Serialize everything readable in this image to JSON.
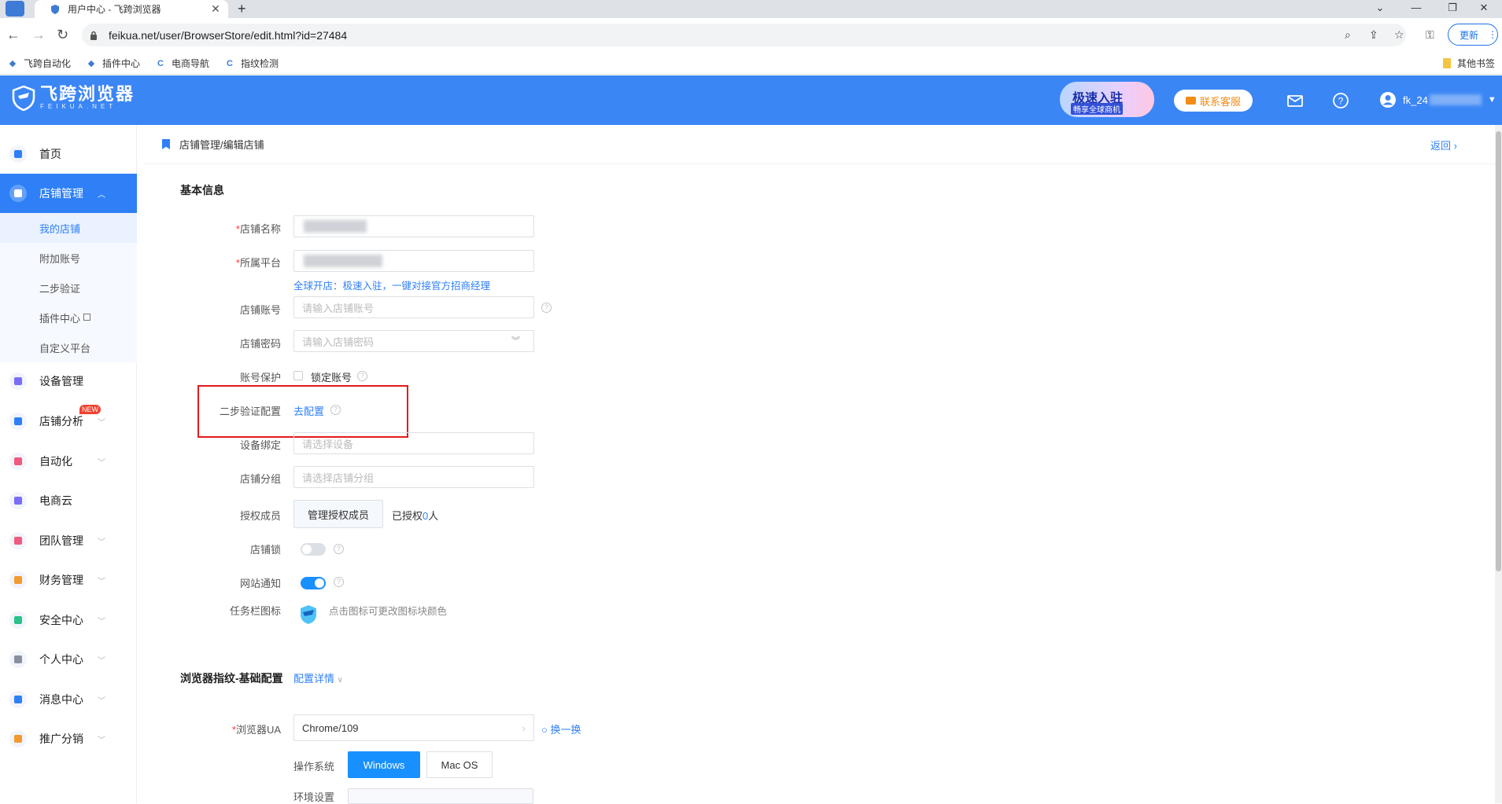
{
  "browser": {
    "tab_title": "用户中心 - 飞跨浏览器",
    "url": "feikua.net/user/BrowserStore/edit.html?id=27484",
    "update_label": "更新",
    "bookmarks": [
      "飞跨自动化",
      "插件中心",
      "电商导航",
      "指纹检测"
    ],
    "other_bookmarks": "其他书签"
  },
  "header": {
    "logo_name": "飞跨浏览器",
    "logo_sub": "FEIKUA.NET",
    "promo_line1": "极速入驻",
    "promo_line2": "畅享全球商机",
    "contact_label": "联系客服",
    "username": "fk_24"
  },
  "sidebar": {
    "items": [
      {
        "label": "首页",
        "color": "#2f80f6"
      },
      {
        "label": "店铺管理",
        "color": "#ffffff"
      },
      {
        "label": "设备管理",
        "color": "#7b6cf6"
      },
      {
        "label": "店铺分析",
        "color": "#2f80f6",
        "badge": "NEW"
      },
      {
        "label": "自动化",
        "color": "#f05a7e"
      },
      {
        "label": "电商云",
        "color": "#7b6cf6"
      },
      {
        "label": "团队管理",
        "color": "#f05a7e"
      },
      {
        "label": "财务管理",
        "color": "#f29a2e"
      },
      {
        "label": "安全中心",
        "color": "#29c287"
      },
      {
        "label": "个人中心",
        "color": "#8a8fa0"
      },
      {
        "label": "消息中心",
        "color": "#2f80f6"
      },
      {
        "label": "推广分销",
        "color": "#f29a2e"
      }
    ],
    "sub_items": [
      "我的店铺",
      "附加账号",
      "二步验证",
      "插件中心",
      "自定义平台"
    ]
  },
  "breadcrumb": "店铺管理/编辑店铺",
  "back_label": "返回",
  "form": {
    "section_basic": "基本信息",
    "store_name_label": "店铺名称",
    "platform_label": "所属平台",
    "platform_hint": "全球开店：极速入驻，一键对接官方招商经理",
    "account_label": "店铺账号",
    "account_placeholder": "请输入店铺账号",
    "password_label": "店铺密码",
    "password_placeholder": "请输入店铺密码",
    "protect_label": "账号保护",
    "lock_account": "锁定账号",
    "twostep_label": "二步验证配置",
    "twostep_link": "去配置",
    "device_label": "设备绑定",
    "device_placeholder": "请选择设备",
    "group_label": "店铺分组",
    "group_placeholder": "请选择店铺分组",
    "members_label": "授权成员",
    "members_button": "管理授权成员",
    "authorized_prefix": "已授权",
    "authorized_count": "0",
    "authorized_suffix": "人",
    "storelock_label": "店铺锁",
    "storelock_on": false,
    "notify_label": "网站通知",
    "notify_on": true,
    "taskbar_label": "任务栏图标",
    "taskbar_hint": "点击图标可更改图标块颜色",
    "section_fp": "浏览器指纹-基础配置",
    "config_detail": "配置详情",
    "ua_label": "浏览器UA",
    "ua_value": "Chrome/109",
    "ua_switch": "换一换",
    "os_label": "操作系统",
    "os_windows": "Windows",
    "os_mac": "Mac OS",
    "env_label": "环境设置"
  }
}
